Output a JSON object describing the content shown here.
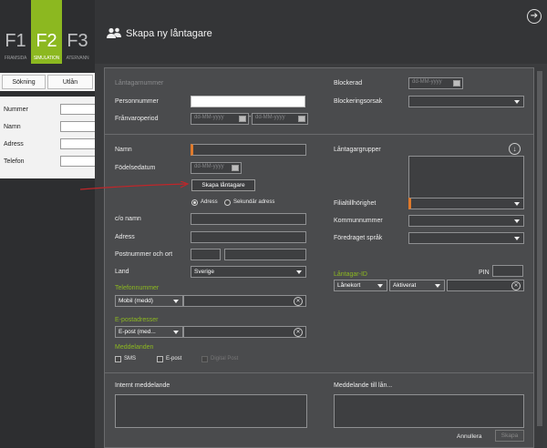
{
  "background_app": {
    "ftabs": [
      {
        "key": "F1",
        "caption": "FRAMSIDA"
      },
      {
        "key": "F2",
        "caption": "SIMULATION"
      },
      {
        "key": "F3",
        "caption": "ATERVANN"
      }
    ],
    "subtabs": [
      "Sökning",
      "Utlån"
    ],
    "fields": [
      "Nummer",
      "Namn",
      "Adress",
      "Telefon"
    ]
  },
  "dialog": {
    "title": "Skapa ny låntagare",
    "left_top": {
      "borrower_number_label": "Låntagarnummer",
      "personal_number_label": "Personnummer",
      "absence_label": "Frånvaroperiod",
      "date_placeholder": "dd-MM-yyyy"
    },
    "right_top": {
      "blocked_label": "Blockerad",
      "blocked_placeholder": "dd-MM-yyyy",
      "block_reason_label": "Blockeringsorsak"
    },
    "person": {
      "name_label": "Namn",
      "birthdate_label": "Födelsedatum",
      "birthdate_placeholder": "dd-MM-yyyy",
      "create_button": "Skapa låntagare",
      "radio_address": "Adress",
      "radio_secondary": "Sekundär adress",
      "co_label": "c/o namn",
      "address_label": "Adress",
      "postal_label": "Postnummer och ort",
      "country_label": "Land",
      "country_value": "Sverige",
      "phone_section": "Telefonnummer",
      "phone_type": "Mobil (medd)",
      "email_section": "E-postadresser",
      "email_type": "E-post (med...",
      "messages_section": "Meddelanden",
      "sms": "SMS",
      "email": "E-post",
      "digital_post": "Digital Post"
    },
    "right_mid": {
      "groups_label": "Låntagargrupper",
      "branch_label": "Filialtillhörighet",
      "municipality_label": "Kommunnummer",
      "language_label": "Föredraget språk",
      "id_section": "Låntagar-ID",
      "pin_label": "PIN",
      "id_type": "Lånekort",
      "id_status": "Aktiverat"
    },
    "bottom": {
      "internal_msg_label": "Internt meddelande",
      "msg_to_borrower_label": "Meddelande till lån...",
      "cancel_button": "Annullera",
      "create_button": "Skapa"
    }
  },
  "colors": {
    "accent": "#8cb820",
    "required": "#e07a2b",
    "arrow": "#c0262a"
  }
}
